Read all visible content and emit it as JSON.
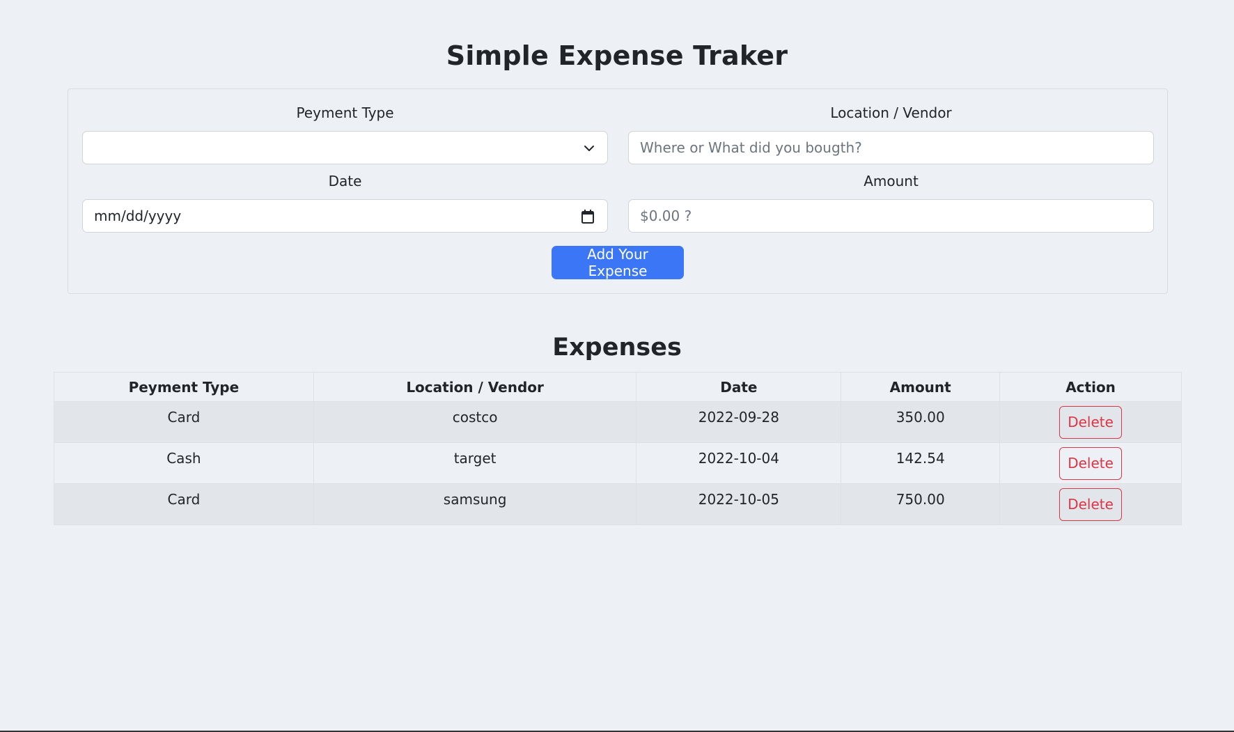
{
  "page": {
    "title": "Simple Expense Traker"
  },
  "form": {
    "payment_type": {
      "label": "Peyment Type",
      "value": "",
      "icon": "chevron-down-icon"
    },
    "location": {
      "label": "Location / Vendor",
      "placeholder": "Where or What did you bougth?"
    },
    "date": {
      "label": "Date",
      "placeholder": "mm/dd/yyyy",
      "icon": "calendar-icon"
    },
    "amount": {
      "label": "Amount",
      "placeholder": "$0.00 ?"
    },
    "submit_label": "Add Your Expense"
  },
  "expenses": {
    "title": "Expenses",
    "columns": [
      "Peyment Type",
      "Location / Vendor",
      "Date",
      "Amount",
      "Action"
    ],
    "rows": [
      {
        "type": "Card",
        "vendor": "costco",
        "date": "2022-09-28",
        "amount": "350.00",
        "action": "Delete"
      },
      {
        "type": "Cash",
        "vendor": "target",
        "date": "2022-10-04",
        "amount": "142.54",
        "action": "Delete"
      },
      {
        "type": "Card",
        "vendor": "samsung",
        "date": "2022-10-05",
        "amount": "750.00",
        "action": "Delete"
      }
    ]
  },
  "colors": {
    "background": "#edf1f5",
    "primary_button": "#3b76f6",
    "danger": "#dc3545",
    "striped_row": "#e2e6ea"
  }
}
